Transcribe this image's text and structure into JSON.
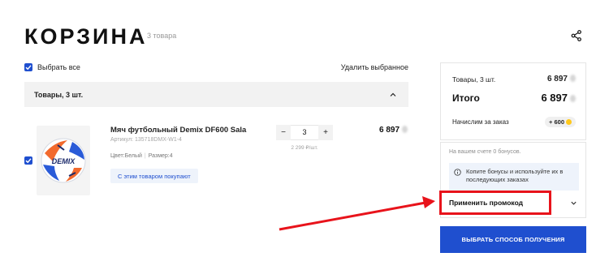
{
  "header": {
    "title": "КОРЗИНА",
    "items_count": "3 товара"
  },
  "toolbar": {
    "select_all": "Выбрать все",
    "delete_selected": "Удалить выбранное"
  },
  "group": {
    "label": "Товары, 3 шт."
  },
  "item": {
    "name": "Мяч футбольный Demix DF600 Sala",
    "article": "Артикул: 135718DMX-W1-4",
    "color": "Цвет:Белый",
    "size": "Размер:4",
    "also_buy": "С этим товаром покупают",
    "quantity": "3",
    "unit_price": "2 299 ₽/шт.",
    "price": "6 897",
    "decrement": "−",
    "increment": "+",
    "image_brand": "DEMIX"
  },
  "summary": {
    "goods_label": "Товары, 3 шт.",
    "goods_value": "6 897",
    "total_label": "Итого",
    "total_value": "6 897",
    "bonus_label": "Начислим за заказ",
    "bonus_value": "+ 600"
  },
  "bonus": {
    "balance": "На вашем счете 0 бонусов.",
    "info": "Копите бонусы и используйте их в последующих заказах",
    "promo": "Применить промокод"
  },
  "cta": {
    "label": "ВЫБРАТЬ СПОСОБ ПОЛУЧЕНИЯ"
  },
  "colors": {
    "accent": "#1f4fcf",
    "annotation": "#e8131b",
    "coin": "#ffc81a"
  }
}
